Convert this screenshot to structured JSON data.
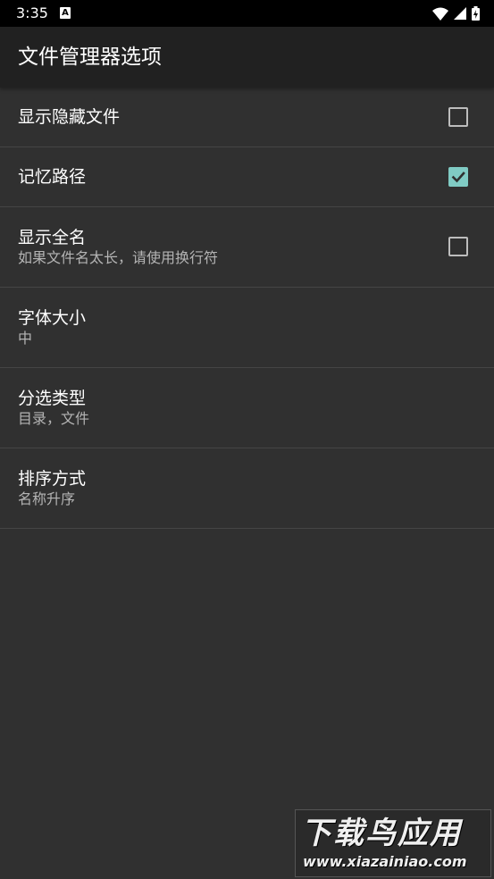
{
  "status_bar": {
    "time": "3:35",
    "notification_icon_letter": "A",
    "icons": [
      "wifi-icon",
      "signal-icon",
      "battery-charging-icon"
    ]
  },
  "toolbar": {
    "title": "文件管理器选项"
  },
  "preferences": [
    {
      "title": "显示隐藏文件",
      "summary": "",
      "checkbox": true,
      "checked": false
    },
    {
      "title": "记忆路径",
      "summary": "",
      "checkbox": true,
      "checked": true
    },
    {
      "title": "显示全名",
      "summary": "如果文件名太长，请使用换行符",
      "checkbox": true,
      "checked": false
    },
    {
      "title": "字体大小",
      "summary": "中",
      "checkbox": false
    },
    {
      "title": "分选类型",
      "summary": "目录，文件",
      "checkbox": false
    },
    {
      "title": "排序方式",
      "summary": "名称升序",
      "checkbox": false
    }
  ],
  "watermark": {
    "brand": "下载鸟应用",
    "url": "www.xiazainiao.com"
  },
  "colors": {
    "background": "#303030",
    "toolbar": "#212121",
    "status_bar": "#000000",
    "accent": "#80cbc4",
    "divider": "#454545"
  }
}
